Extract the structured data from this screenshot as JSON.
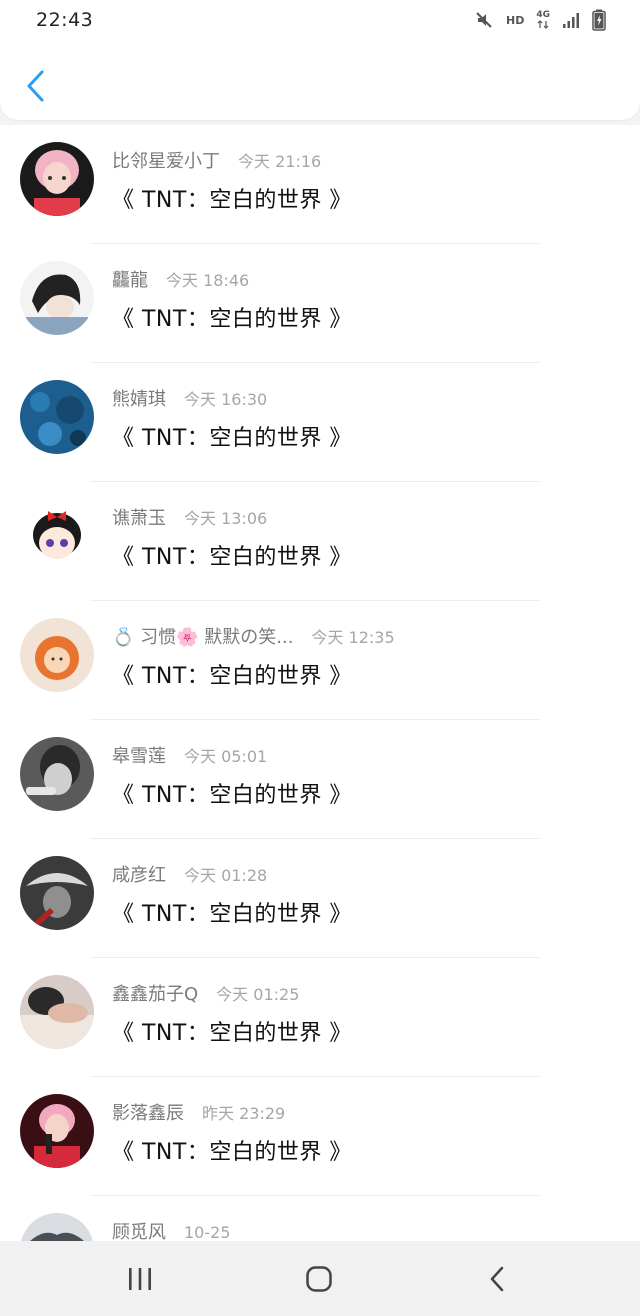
{
  "status_bar": {
    "time": "22:43",
    "hd_label": "HD",
    "network_label": "4G",
    "icons": [
      "mute-icon",
      "signal-icon",
      "battery-icon"
    ]
  },
  "header": {
    "back_icon": "chevron-left-icon",
    "accent_color": "#2a9ef5"
  },
  "comments": [
    {
      "name": "比邻星爱小丁",
      "time": "今天 21:16",
      "title": "《 TNT：空白的世界 》"
    },
    {
      "name": "龘龍",
      "time": "今天 18:46",
      "title": "《 TNT：空白的世界 》"
    },
    {
      "name": "熊婧琪",
      "time": "今天 16:30",
      "title": "《 TNT：空白的世界 》"
    },
    {
      "name": "谯萧玉",
      "time": "今天 13:06",
      "title": "《 TNT：空白的世界 》"
    },
    {
      "name": "💍 习惯🌸 默默の笑...",
      "time": "今天 12:35",
      "title": "《 TNT：空白的世界 》"
    },
    {
      "name": "皋雪莲",
      "time": "今天 05:01",
      "title": "《 TNT：空白的世界 》"
    },
    {
      "name": "咸彦红",
      "time": "今天 01:28",
      "title": "《 TNT：空白的世界 》"
    },
    {
      "name": "鑫鑫茄子Q",
      "time": "今天 01:25",
      "title": "《 TNT：空白的世界 》"
    },
    {
      "name": "影落鑫辰",
      "time": "昨天 23:29",
      "title": "《 TNT：空白的世界 》"
    },
    {
      "name": "顾觅风",
      "time": "10-25",
      "title": ""
    }
  ],
  "nav_bar": {
    "icons": [
      "recent-apps-icon",
      "home-icon",
      "back-icon"
    ]
  }
}
